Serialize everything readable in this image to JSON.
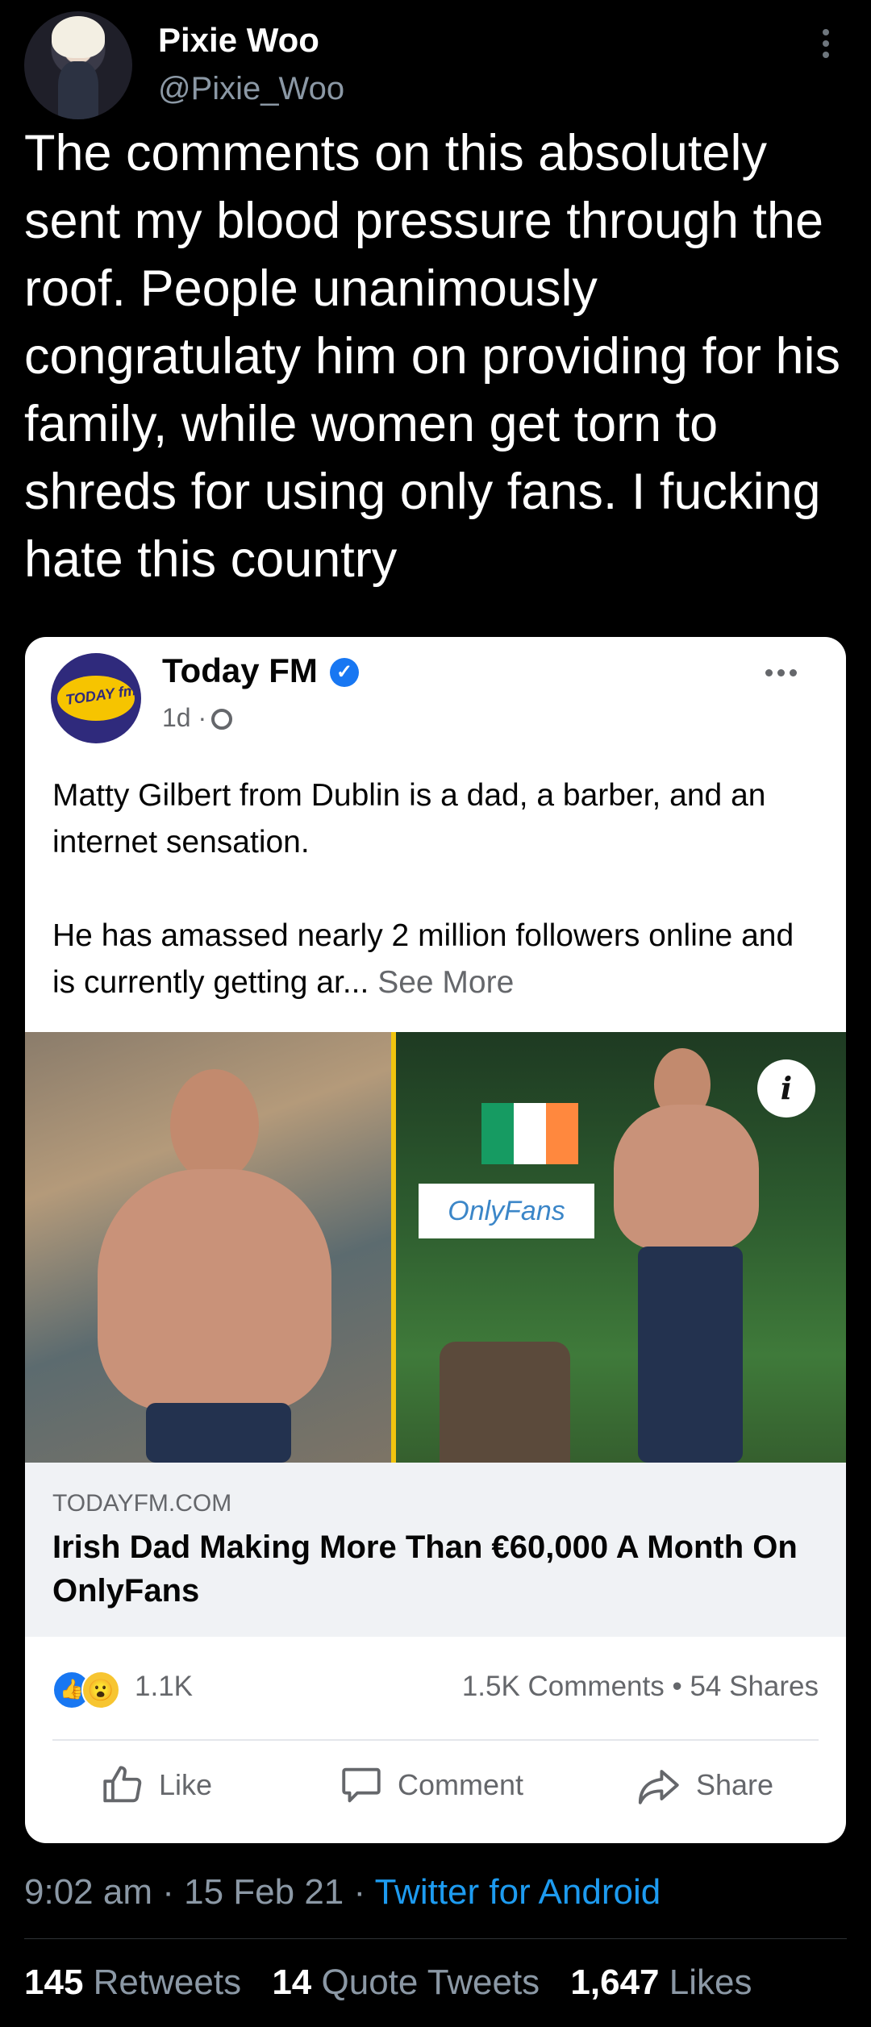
{
  "tweet": {
    "display_name": "Pixie Woo",
    "handle": "@Pixie_Woo",
    "text": "The comments on this absolutely sent my blood pressure through the roof. People unanimously congratulaty him on providing for his family, while women get torn to shreds for using only fans. I fucking hate this country",
    "time": "9:02 am",
    "date": "15 Feb 21",
    "dot1": "·",
    "dot2": "·",
    "source": "Twitter for Android",
    "retweets_count": "145",
    "retweets_label": "Retweets",
    "quote_count": "14",
    "quote_label": "Quote Tweets",
    "likes_count": "1,647",
    "likes_label": "Likes"
  },
  "fb_post": {
    "page_name": "Today FM",
    "logo_text": "TODAY fm",
    "age": "1d ·",
    "body_line1": "Matty Gilbert from Dublin is a dad, a barber, and an internet sensation.",
    "body_line2": "He has amassed nearly 2 million followers online and is currently getting ar...",
    "see_more": "See More",
    "image_badge": "OnlyFans",
    "link_domain": "TODAYFM.COM",
    "link_title": "Irish Dad Making More Than €60,000 A Month On OnlyFans",
    "reaction_count": "1.1K",
    "comments_shares": "1.5K Comments • 54 Shares",
    "like_label": "Like",
    "comment_label": "Comment",
    "share_label": "Share"
  },
  "colors": {
    "background": "#000000",
    "link_blue": "#1d9bf0",
    "fb_blue": "#1877f2",
    "muted": "#8b98a5"
  },
  "icons": [
    "more-vertical-icon",
    "verified-icon",
    "globe-icon",
    "more-horizontal-icon",
    "info-icon",
    "like-reaction-icon",
    "wow-reaction-icon",
    "thumbs-up-icon",
    "comment-bubble-icon",
    "share-arrow-icon"
  ]
}
